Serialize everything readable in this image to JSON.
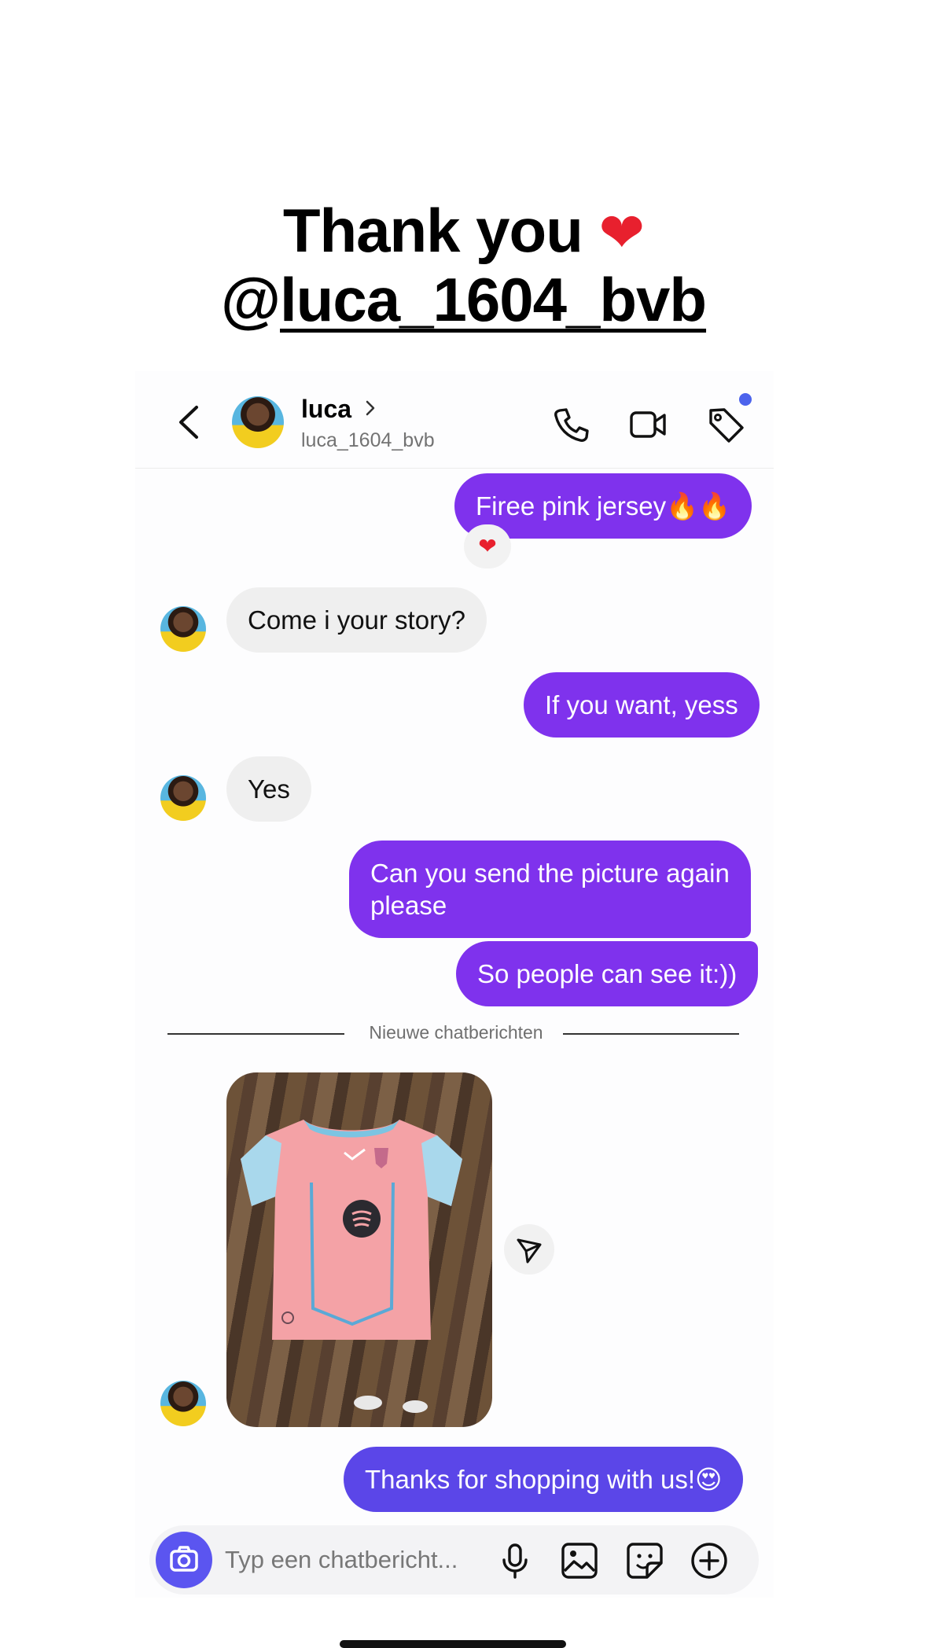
{
  "headline": {
    "line1_text": "Thank you",
    "line1_emoji": "❤",
    "line2_handle": "luca_1604_bvb",
    "threads_symbol": "@"
  },
  "header": {
    "contact_name": "luca",
    "contact_handle": "luca_1604_bvb",
    "icons": [
      "back-icon",
      "chevron-right-icon",
      "phone-icon",
      "video-icon",
      "tag-icon"
    ],
    "notification_dot_color": "#4c63ec"
  },
  "messages": [
    {
      "from": "me",
      "text": "Firee pink jersey🔥🔥",
      "reaction": "❤"
    },
    {
      "from": "them",
      "text": "Come i your story?"
    },
    {
      "from": "me",
      "text": "If you want, yess"
    },
    {
      "from": "them",
      "text": "Yes"
    },
    {
      "from": "me",
      "text_line1": "Can you send the picture again",
      "text_line2": "please"
    },
    {
      "from": "me",
      "text": "So people can see it:))"
    },
    {
      "from": "them",
      "type": "image",
      "alt": "pink football jersey on wooden floor"
    },
    {
      "from": "me",
      "text": "Thanks for shopping with us!😍"
    }
  ],
  "divider": {
    "label": "Nieuwe chatberichten"
  },
  "composer": {
    "placeholder": "Typ een chatbericht...",
    "icons": [
      "camera-icon",
      "microphone-icon",
      "image-icon",
      "sticker-icon",
      "plus-icon"
    ]
  },
  "colors": {
    "outgoing_bubble": "#7f32ed",
    "incoming_bubble": "#efefef",
    "last_bubble": "#5b46e8",
    "camera_button": "#5b55f0"
  }
}
